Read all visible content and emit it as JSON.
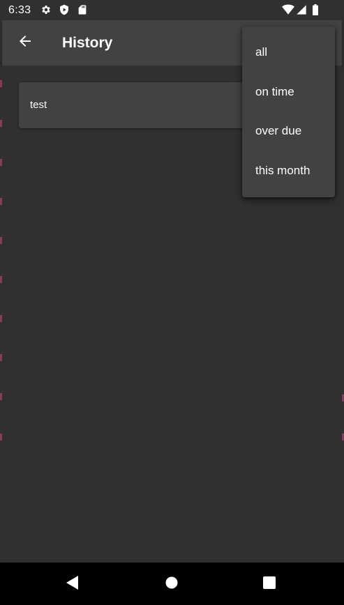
{
  "status_bar": {
    "time": "6:33",
    "left_icons": [
      "gear-icon",
      "shield-play-icon",
      "sd-card-icon"
    ],
    "right_icons": [
      "wifi-icon",
      "cell-signal-icon",
      "battery-icon"
    ]
  },
  "app_bar": {
    "back_icon": "arrow-back-icon",
    "title": "History"
  },
  "list": {
    "items": [
      {
        "label": "test"
      }
    ]
  },
  "popup_menu": {
    "items": [
      {
        "label": "all"
      },
      {
        "label": "on time"
      },
      {
        "label": "over due"
      },
      {
        "label": "this month"
      }
    ]
  },
  "nav_bar": {
    "icons": [
      "nav-back-icon",
      "nav-home-icon",
      "nav-recents-icon"
    ]
  },
  "colors": {
    "background": "#303030",
    "surface": "#424242",
    "text": "#ffffff",
    "nav_bar": "#000000",
    "edge_accent": "#8a3a5c"
  }
}
